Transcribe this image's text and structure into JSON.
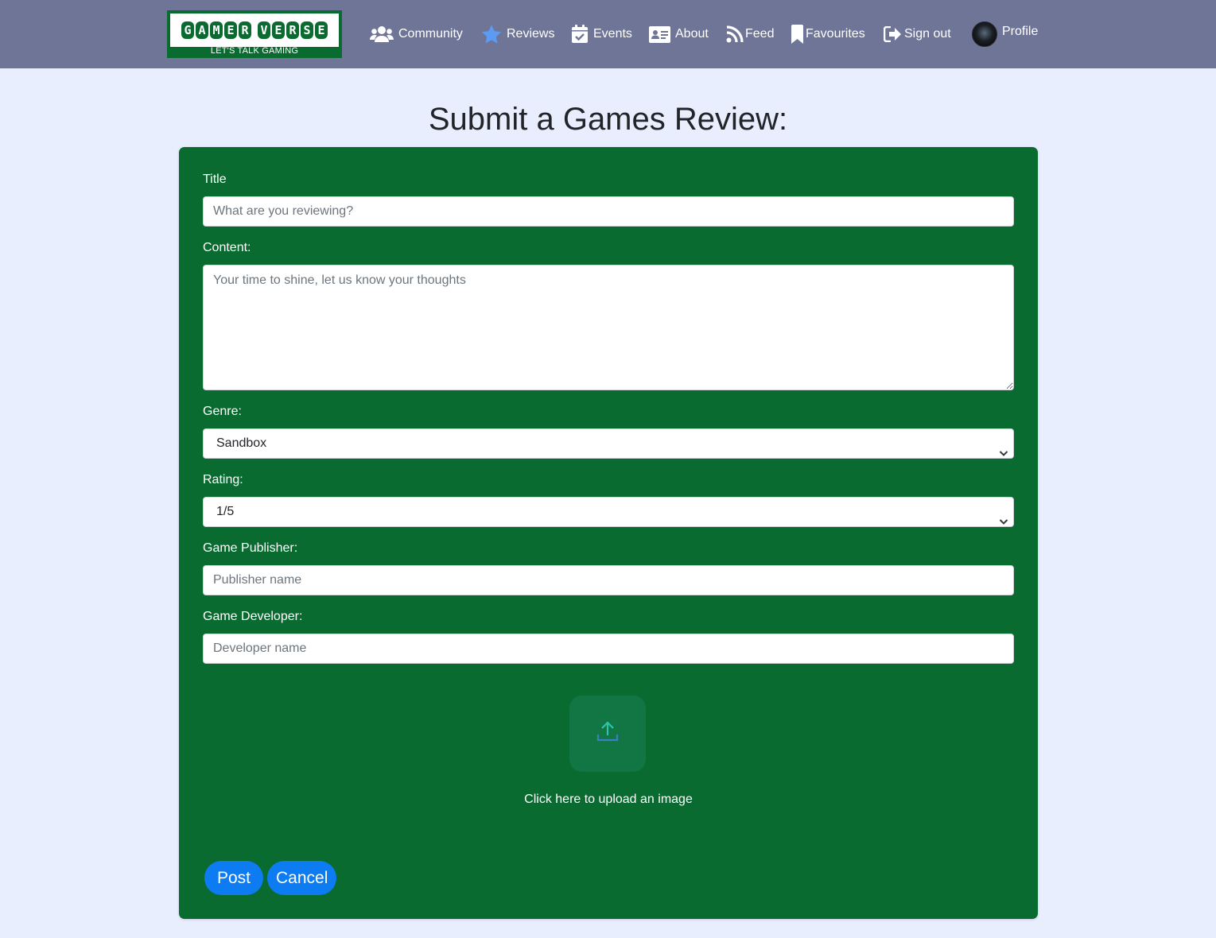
{
  "nav": {
    "logo_word_left": [
      "G",
      "A",
      "M",
      "E",
      "R"
    ],
    "logo_word_right": [
      "V",
      "E",
      "R",
      "S",
      "E"
    ],
    "logo_tagline": "LET'S TALK GAMING",
    "items": [
      {
        "label": "Community",
        "icon": "users-icon"
      },
      {
        "label": "Reviews",
        "icon": "star-icon",
        "icon_color": "#5b9bf3"
      },
      {
        "label": "Events",
        "icon": "calendar-check-icon"
      },
      {
        "label": "About",
        "icon": "id-card-icon"
      },
      {
        "label": "Feed",
        "icon": "rss-icon"
      },
      {
        "label": "Favourites",
        "icon": "bookmark-icon"
      },
      {
        "label": "Sign out",
        "icon": "sign-out-icon"
      },
      {
        "label": "Profile",
        "icon": "avatar"
      }
    ]
  },
  "page": {
    "title": "Submit a Games Review:"
  },
  "form": {
    "title": {
      "label": "Title",
      "placeholder": "What are you reviewing?",
      "value": ""
    },
    "content": {
      "label": "Content:",
      "placeholder": "Your time to shine, let us know your thoughts",
      "value": ""
    },
    "genre": {
      "label": "Genre:",
      "selected": "Sandbox"
    },
    "rating": {
      "label": "Rating:",
      "selected": "1/5"
    },
    "publisher": {
      "label": "Game Publisher:",
      "placeholder": "Publisher name",
      "value": ""
    },
    "developer": {
      "label": "Game Developer:",
      "placeholder": "Developer name",
      "value": ""
    },
    "upload": {
      "label": "Click here to upload an image",
      "icon": "upload-icon"
    },
    "post_label": "Post",
    "cancel_label": "Cancel"
  },
  "colors": {
    "navbar_bg": "#6e7597",
    "page_bg": "#e8eefe",
    "card_bg": "#0a6b31",
    "button_bg": "#0d7bf2"
  }
}
